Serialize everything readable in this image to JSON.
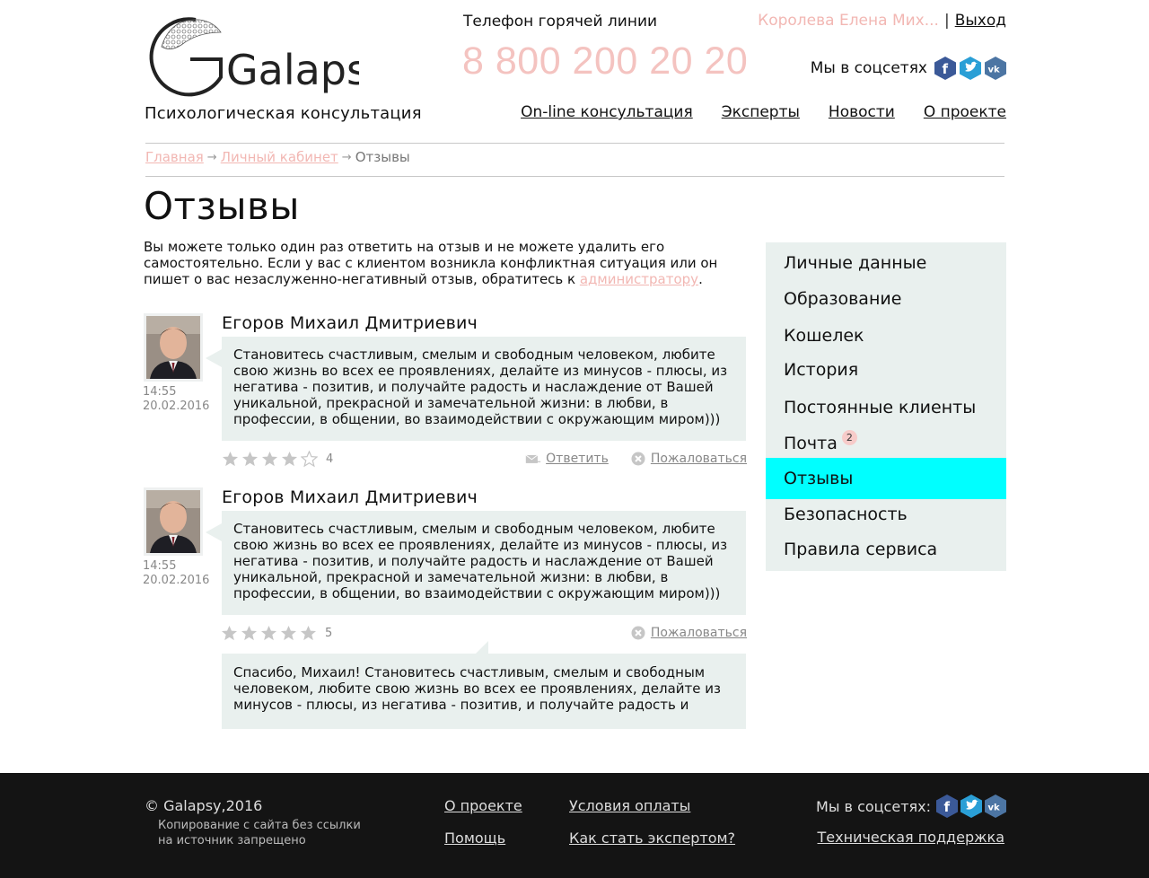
{
  "header": {
    "logo_text": "Galapsy",
    "tagline": "Психологическая консультация",
    "hotline_label": "Телефон горячей линии",
    "hotline_phone": "8 800 200 20 20",
    "user_name": "Королева Елена Мих...",
    "separator": "|",
    "logout": "Выход",
    "social_label": "Мы в соцсетях",
    "nav": [
      {
        "label": "On-line консультация"
      },
      {
        "label": "Эксперты"
      },
      {
        "label": "Новости"
      },
      {
        "label": "О проекте"
      }
    ]
  },
  "breadcrumb": {
    "items": [
      "Главная",
      "Личный кабинет",
      "Отзывы"
    ]
  },
  "page": {
    "title": "Отзывы",
    "intro_text": "Вы можете только один раз ответить на отзыв и не можете удалить его самостоятельно. Если у вас с клиентом возникла конфликтная ситуация или он пишет о вас незаслуженно-негативный отзыв, обратитесь к ",
    "intro_link": "администратору",
    "intro_end": "."
  },
  "reviews": [
    {
      "author": "Егоров Михаил Дмитриевич",
      "time": "14:55",
      "date": "20.02.2016",
      "text": "Становитесь счастливым, смелым и свободным человеком, любите свою жизнь во всех ее проявлениях, делайте из минусов - плюсы, из негатива - позитив, и получайте радость и наслаждение от Вашей уникальной, прекрасной и замечательной жизни: в любви, в профессии, в общении, во взаимодействии с окружающим миром)))",
      "rating": 4,
      "reply_action": "Ответить",
      "complain_action": "Пожаловаться"
    },
    {
      "author": "Егоров Михаил Дмитриевич",
      "time": "14:55",
      "date": "20.02.2016",
      "text": "Становитесь счастливым, смелым и свободным человеком, любите свою жизнь во всех ее проявлениях, делайте из минусов - плюсы, из негатива - позитив, и получайте радость и наслаждение от Вашей уникальной, прекрасной и замечательной жизни: в любви, в профессии, в общении, во взаимодействии с окружающим миром)))",
      "rating": 5,
      "complain_action": "Пожаловаться",
      "reply_text": "Спасибо, Михаил! Становитесь счастливым, смелым и свободным человеком, любите свою жизнь во всех ее проявлениях, делайте из минусов - плюсы, из негатива - позитив, и получайте радость и"
    }
  ],
  "sidebar": {
    "items": [
      {
        "label": "Личные данные"
      },
      {
        "label": "Образование"
      },
      {
        "label": "Кошелек"
      },
      {
        "label": "История"
      },
      {
        "label": "Постоянные клиенты"
      },
      {
        "label": "Почта",
        "badge": "2"
      },
      {
        "label": "Отзывы",
        "active": true
      },
      {
        "label": "Безопасность"
      },
      {
        "label": "Правила сервиса"
      }
    ]
  },
  "footer": {
    "copyright": "© Galapsy,2016",
    "note": "Копирование с сайта без ссылки на источник запрещено",
    "links": [
      "О проекте",
      "Помощь",
      "Условия оплаты",
      "Как стать экспертом?"
    ],
    "social_label": "Мы в соцсетях:",
    "support": "Техническая поддержка"
  },
  "colors": {
    "accent_pink": "#f2b7b3",
    "active_item": "#00ffff",
    "panel_bg": "#e9f0ee",
    "footer_bg": "#141414",
    "facebook": "#3b5998",
    "twitter": "#2a9fd6",
    "vk": "#4c75a3"
  },
  "icons": [
    "facebook-icon",
    "twitter-icon",
    "vk-icon",
    "star-icon",
    "reply-envelope-icon",
    "complain-x-icon"
  ]
}
